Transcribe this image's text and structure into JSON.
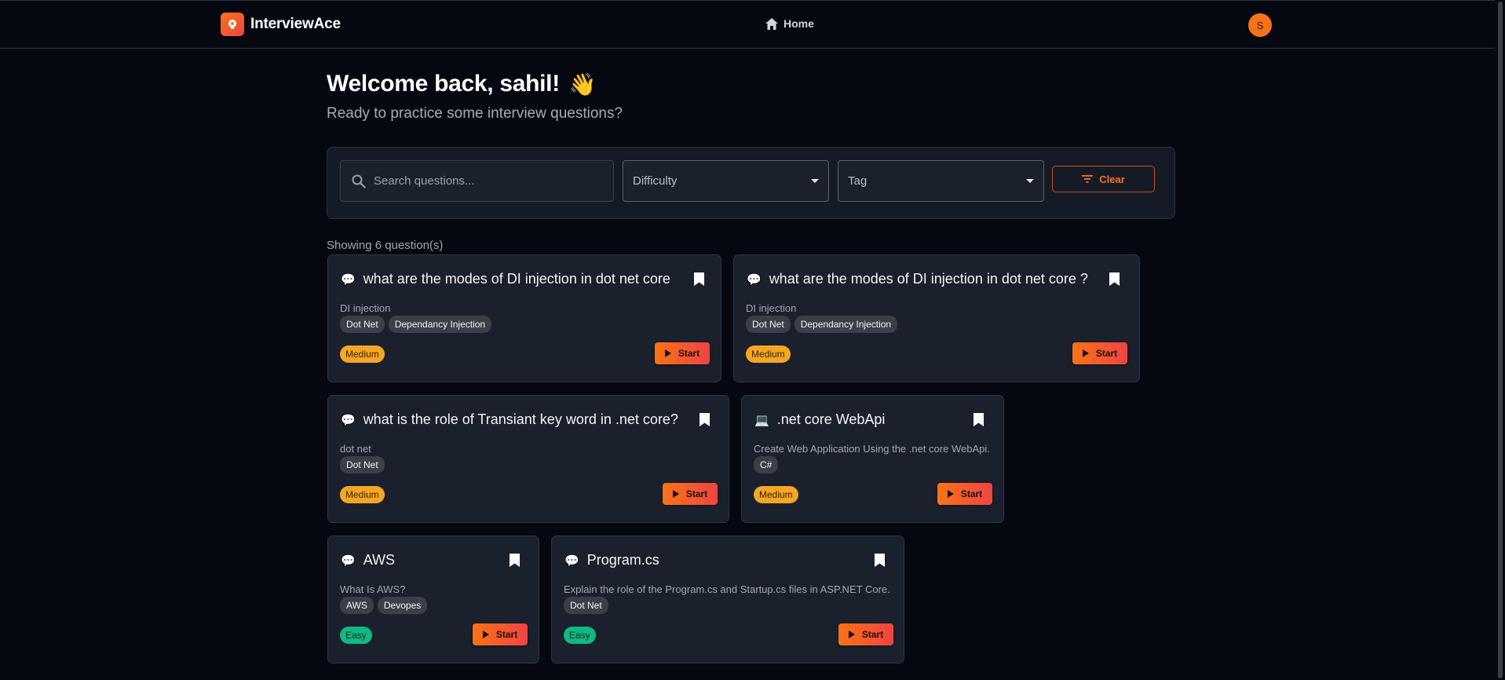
{
  "header": {
    "app_name": "InterviewAce",
    "nav_home": "Home",
    "avatar_initial": "S"
  },
  "welcome": {
    "title": "Welcome back, sahil!",
    "wave": "👋",
    "subtitle": "Ready to practice some interview questions?"
  },
  "filters": {
    "search_placeholder": "Search questions...",
    "difficulty_label": "Difficulty",
    "tag_label": "Tag",
    "clear_label": "Clear"
  },
  "showing_text": "Showing 6 question(s)",
  "start_label": "Start",
  "questions": [
    {
      "icon": "💬",
      "title": "what are the modes of DI injection in dot net core",
      "description": "DI injection",
      "tags": [
        "Dot Net",
        "Dependancy Injection"
      ],
      "difficulty": "Medium"
    },
    {
      "icon": "💬",
      "title": "what are the modes of DI injection in dot net core ?",
      "description": "DI injection",
      "tags": [
        "Dot Net",
        "Dependancy Injection"
      ],
      "difficulty": "Medium"
    },
    {
      "icon": "💬",
      "title": "what is the role of Transiant key word in .net core?",
      "description": "dot net",
      "tags": [
        "Dot Net"
      ],
      "difficulty": "Medium"
    },
    {
      "icon": "💻",
      "title": ".net core WebApi",
      "description": "Create Web Application Using the .net core WebApi.",
      "tags": [
        "C#"
      ],
      "difficulty": "Medium"
    },
    {
      "icon": "💬",
      "title": "AWS",
      "description": "What Is AWS?",
      "tags": [
        "AWS",
        "Devopes"
      ],
      "difficulty": "Easy"
    },
    {
      "icon": "💬",
      "title": "Program.cs",
      "description": "Explain the role of the Program.cs and Startup.cs files in ASP.NET Core.",
      "tags": [
        "Dot Net"
      ],
      "difficulty": "Easy"
    }
  ],
  "colors": {
    "accent": "#f97316",
    "medium": "#f5a623",
    "easy": "#10b981",
    "background": "#050811",
    "card": "#1b212c"
  }
}
